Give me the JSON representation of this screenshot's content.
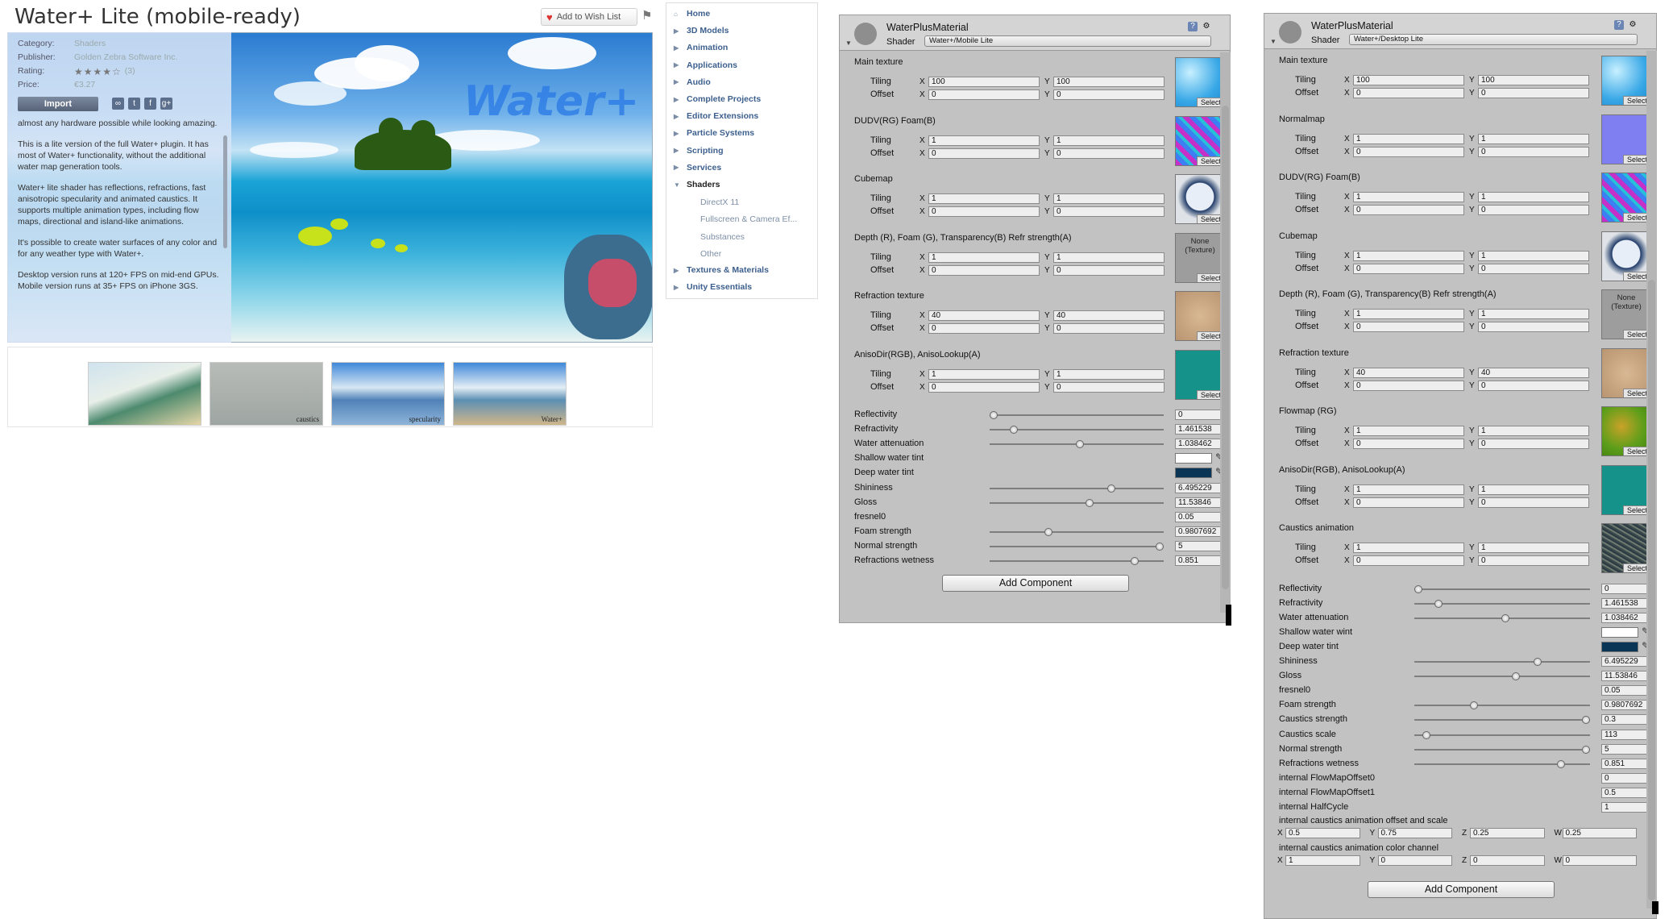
{
  "store": {
    "title": "Water+ Lite (mobile-ready)",
    "wishlist_label": "Add to Wish List",
    "flag_icon": "flag-icon",
    "hero_logo": "Water+",
    "info": {
      "category_label": "Category:",
      "category_value": "Shaders",
      "publisher_label": "Publisher:",
      "publisher_value": "Golden Zebra Software Inc.",
      "rating_label": "Rating:",
      "rating_stars": "★★★★☆",
      "rating_count": "(3)",
      "price_label": "Price:",
      "price_value": "€3.27",
      "import_label": "Import"
    },
    "description": [
      "almost any hardware possible while looking amazing.",
      "This is a lite version of the full Water+ plugin. It has most of Water+ functionality, without the additional water map generation tools.",
      "Water+ lite shader has reflections, refractions, fast anisotropic specularity and animated caustics. It supports multiple animation types, including flow maps, directional and island-like animations.",
      "It's possible to create water surfaces of any color and for any weather type with Water+.",
      "Desktop version runs at 120+ FPS on mid-end GPUs. Mobile version runs at 35+ FPS on iPhone 3GS."
    ],
    "thumb_captions": [
      "",
      "caustics",
      "specularity",
      "Water+"
    ]
  },
  "categories": {
    "items": [
      {
        "label": "Home"
      },
      {
        "label": "3D Models"
      },
      {
        "label": "Animation"
      },
      {
        "label": "Applications"
      },
      {
        "label": "Audio"
      },
      {
        "label": "Complete Projects"
      },
      {
        "label": "Editor Extensions"
      },
      {
        "label": "Particle Systems"
      },
      {
        "label": "Scripting"
      },
      {
        "label": "Services"
      },
      {
        "label": "Shaders"
      }
    ],
    "shader_subs": [
      "DirectX 11",
      "Fullscreen & Camera Ef...",
      "Substances",
      "Other"
    ],
    "bottom_items": [
      {
        "label": "Textures & Materials"
      },
      {
        "label": "Unity Essentials"
      }
    ]
  },
  "inspector_mobile": {
    "material_name": "WaterPlusMaterial",
    "shader_label": "Shader",
    "shader_value": "Water+/Mobile Lite",
    "tiling_label": "Tiling",
    "offset_label": "Offset",
    "select_label": "Select",
    "none_texture": "None\n(Texture)",
    "textures": [
      {
        "name": "Main texture",
        "tile_x": "100",
        "tile_y": "100",
        "off_x": "0",
        "off_y": "0"
      },
      {
        "name": "DUDV(RG) Foam(B)",
        "tile_x": "1",
        "tile_y": "1",
        "off_x": "0",
        "off_y": "0"
      },
      {
        "name": "Cubemap",
        "tile_x": "1",
        "tile_y": "1",
        "off_x": "0",
        "off_y": "0"
      },
      {
        "name": "Depth (R), Foam (G), Transparency(B) Refr strength(A)",
        "tile_x": "1",
        "tile_y": "1",
        "off_x": "0",
        "off_y": "0"
      },
      {
        "name": "Refraction texture",
        "tile_x": "40",
        "tile_y": "40",
        "off_x": "0",
        "off_y": "0"
      },
      {
        "name": "AnisoDir(RGB), AnisoLookup(A)",
        "tile_x": "1",
        "tile_y": "1",
        "off_x": "0",
        "off_y": "0"
      }
    ],
    "properties": [
      {
        "label": "Reflectivity",
        "value": "0",
        "level": 0.0
      },
      {
        "label": "Refractivity",
        "value": "1.461538",
        "level": 0.12
      },
      {
        "label": "Water attenuation",
        "value": "1.038462",
        "level": 0.52
      },
      {
        "label": "Shallow water tint",
        "color": "#ffffff"
      },
      {
        "label": "Deep water tint",
        "color": "#0a3555"
      },
      {
        "label": "Shininess",
        "value": "6.495229",
        "level": 0.71
      },
      {
        "label": "Gloss",
        "value": "11.53846",
        "level": 0.58
      },
      {
        "label": "fresnel0",
        "value": "0.05"
      },
      {
        "label": "Foam strength",
        "value": "0.9807692",
        "level": 0.33
      },
      {
        "label": "Normal strength",
        "value": "5",
        "level": 1.0
      },
      {
        "label": "Refractions wetness",
        "value": "0.851",
        "level": 0.85
      }
    ],
    "add_component": "Add Component"
  },
  "inspector_desktop": {
    "material_name": "WaterPlusMaterial",
    "shader_label": "Shader",
    "shader_value": "Water+/Desktop Lite",
    "tiling_label": "Tiling",
    "offset_label": "Offset",
    "select_label": "Select",
    "none_texture": "None\n(Texture)",
    "textures": [
      {
        "name": "Main texture",
        "tile_x": "100",
        "tile_y": "100",
        "off_x": "0",
        "off_y": "0"
      },
      {
        "name": "Normalmap",
        "tile_x": "1",
        "tile_y": "1",
        "off_x": "0",
        "off_y": "0"
      },
      {
        "name": "DUDV(RG) Foam(B)",
        "tile_x": "1",
        "tile_y": "1",
        "off_x": "0",
        "off_y": "0"
      },
      {
        "name": "Cubemap",
        "tile_x": "1",
        "tile_y": "1",
        "off_x": "0",
        "off_y": "0"
      },
      {
        "name": "Depth (R), Foam (G), Transparency(B) Refr strength(A)",
        "tile_x": "1",
        "tile_y": "1",
        "off_x": "0",
        "off_y": "0"
      },
      {
        "name": "Refraction texture",
        "tile_x": "40",
        "tile_y": "40",
        "off_x": "0",
        "off_y": "0"
      },
      {
        "name": "Flowmap (RG)",
        "tile_x": "1",
        "tile_y": "1",
        "off_x": "0",
        "off_y": "0"
      },
      {
        "name": "AnisoDir(RGB), AnisoLookup(A)",
        "tile_x": "1",
        "tile_y": "1",
        "off_x": "0",
        "off_y": "0"
      },
      {
        "name": "Caustics animation",
        "tile_x": "1",
        "tile_y": "1",
        "off_x": "0",
        "off_y": "0"
      }
    ],
    "properties": [
      {
        "label": "Reflectivity",
        "value": "0",
        "level": 0.0
      },
      {
        "label": "Refractivity",
        "value": "1.461538",
        "level": 0.12
      },
      {
        "label": "Water attenuation",
        "value": "1.038462",
        "level": 0.52
      },
      {
        "label": "Shallow water wint",
        "color": "#ffffff"
      },
      {
        "label": "Deep water tint",
        "color": "#0a3555"
      },
      {
        "label": "Shininess",
        "value": "6.495229",
        "level": 0.71
      },
      {
        "label": "Gloss",
        "value": "11.53846",
        "level": 0.58
      },
      {
        "label": "fresnel0",
        "value": "0.05"
      },
      {
        "label": "Foam strength",
        "value": "0.9807692",
        "level": 0.33
      },
      {
        "label": "Caustics strength",
        "value": "0.3",
        "level": 1.0
      },
      {
        "label": "Caustics scale",
        "value": "113",
        "level": 0.05
      },
      {
        "label": "Normal strength",
        "value": "5",
        "level": 1.0
      },
      {
        "label": "Refractions wetness",
        "value": "0.851",
        "level": 0.85
      },
      {
        "label": "internal FlowMapOffset0",
        "value": "0"
      },
      {
        "label": "internal FlowMapOffset1",
        "value": "0.5"
      },
      {
        "label": "internal HalfCycle",
        "value": "1"
      }
    ],
    "vec1_label": "internal caustics animation offset and scale",
    "vec1": {
      "x": "0.5",
      "y": "0.75",
      "z": "0.25",
      "w": "0.25"
    },
    "vec2_label": "internal caustics animation color channel",
    "vec2": {
      "x": "1",
      "y": "0",
      "z": "0",
      "w": "0"
    },
    "add_component": "Add Component"
  }
}
